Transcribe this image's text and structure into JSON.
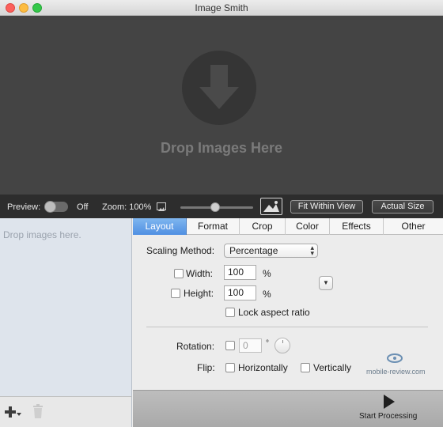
{
  "window": {
    "title": "Image Smith"
  },
  "dropzone": {
    "text": "Drop Images Here",
    "icon": "download-arrow-icon"
  },
  "preview_bar": {
    "preview_label": "Preview:",
    "preview_state": "Off",
    "zoom_label": "Zoom: 100%",
    "fit_button": "Fit Within View",
    "actual_button": "Actual Size"
  },
  "sidebar": {
    "placeholder": "Drop images here."
  },
  "tabs": [
    {
      "label": "Layout",
      "active": true
    },
    {
      "label": "Format"
    },
    {
      "label": "Crop"
    },
    {
      "label": "Color"
    },
    {
      "label": "Effects"
    },
    {
      "label": "Other"
    }
  ],
  "layout": {
    "scaling_label": "Scaling Method:",
    "scaling_value": "Percentage",
    "width_label": "Width:",
    "width_value": "100",
    "width_unit": "%",
    "height_label": "Height:",
    "height_value": "100",
    "height_unit": "%",
    "aspect_label": "Lock aspect ratio",
    "rotation_label": "Rotation:",
    "rotation_value": "0",
    "rotation_unit": "°",
    "flip_label": "Flip:",
    "flip_h": "Horizontally",
    "flip_v": "Vertically"
  },
  "watermark": {
    "text": "mobile-review.com"
  },
  "process": {
    "label": "Start Processing"
  },
  "colors": {
    "accent": "#4f8fe2",
    "dropzone_bg": "#444444",
    "sidebar_bg": "#dee4ec"
  }
}
